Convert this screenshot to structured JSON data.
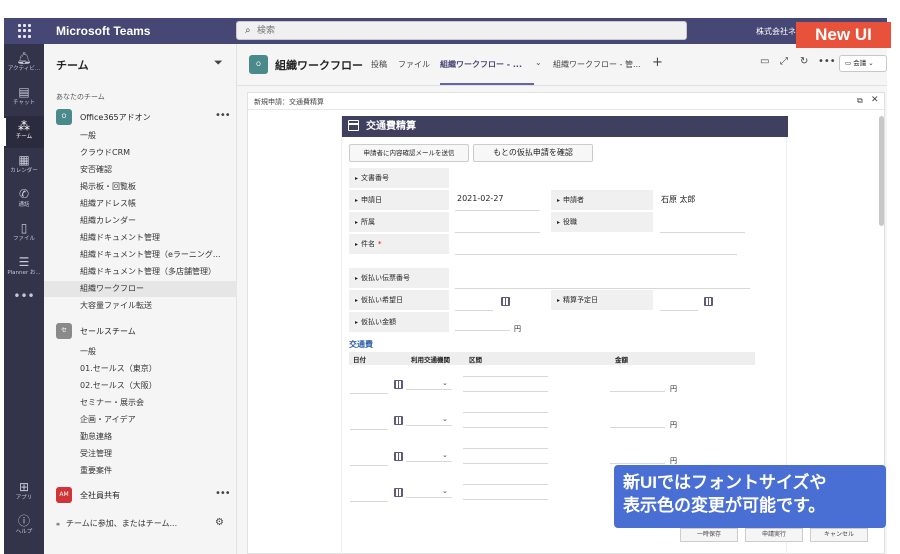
{
  "topbar": {
    "app_title": "Microsoft Teams",
    "search_placeholder": "検索",
    "org_name": "株式会社ネ",
    "badge": "New UI"
  },
  "rail": {
    "items": [
      {
        "label": "アクティビ...",
        "icon": "bell-icon"
      },
      {
        "label": "チャット",
        "icon": "chat-icon"
      },
      {
        "label": "チーム",
        "icon": "teams-icon"
      },
      {
        "label": "カレンダー",
        "icon": "calendar-icon"
      },
      {
        "label": "通話",
        "icon": "phone-icon"
      },
      {
        "label": "ファイル",
        "icon": "file-icon"
      },
      {
        "label": "Planner お...",
        "icon": "planner-icon"
      },
      {
        "label": "",
        "icon": "more-icon"
      },
      {
        "label": "アプリ",
        "icon": "apps-icon"
      },
      {
        "label": "ヘルプ",
        "icon": "help-icon"
      }
    ]
  },
  "team_panel": {
    "title": "チーム",
    "section_label": "あなたのチーム",
    "teams": [
      {
        "name": "Office365アドオン",
        "avatar": "O",
        "color": "#4a8a8a",
        "channels": [
          "一般",
          "クラウドCRM",
          "安否確認",
          "掲示板・回覧板",
          "組織アドレス帳",
          "組織カレンダー",
          "組織ドキュメント管理",
          "組織ドキュメント管理（eラーニング...",
          "組織ドキュメント管理（多店舗管理）",
          "組織ワークフロー",
          "大容量ファイル転送"
        ]
      },
      {
        "name": "セールスチーム",
        "avatar": "セ",
        "color": "#8a8a8a",
        "channels": [
          "一般",
          "01.セールス（東京）",
          "02.セールス（大阪）",
          "セミナー・展示会",
          "企画・アイデア",
          "勤怠連絡",
          "受注管理",
          "重要案件"
        ]
      },
      {
        "name": "全社員共有",
        "avatar": "AM",
        "color": "#d13438",
        "channels": []
      }
    ],
    "selected_channel": "組織ワークフロー",
    "join_label": "チームに参加、またはチーム..."
  },
  "channel_header": {
    "avatar": "O",
    "title": "組織ワークフロー",
    "tabs": [
      "投稿",
      "ファイル",
      "組織ワークフロー - ...",
      "組織ワークフロー - 管..."
    ],
    "active_tab": 2,
    "meet_label": "会議"
  },
  "pane": {
    "title": "新規申請：交通費精算",
    "form": {
      "header": "交通費精算",
      "buttons": [
        "申請者に内容確認メールを送信",
        "もとの仮払申請を確認"
      ],
      "fields": {
        "doc_no": "文書番号",
        "apply_date": "申請日",
        "apply_date_value": "2021-02-27",
        "applicant": "申請者",
        "applicant_value": "石原 太郎",
        "dept": "所属",
        "position": "役職",
        "subject": "件名",
        "required_mark": "*",
        "advance_slip": "仮払い伝票番号",
        "advance_date": "仮払い希望日",
        "settle_date": "精算予定日",
        "advance_amount": "仮払い金額",
        "yen": "円"
      },
      "transport": {
        "section": "交通費",
        "columns": [
          "日付",
          "利用交通機関",
          "区間",
          "金額"
        ]
      }
    }
  },
  "callout": {
    "line1": "新UIではフォントサイズや",
    "line2": "表示色の変更が可能です。"
  },
  "bottom_buttons": [
    "一時保存",
    "申請実行",
    "キャンセル"
  ]
}
